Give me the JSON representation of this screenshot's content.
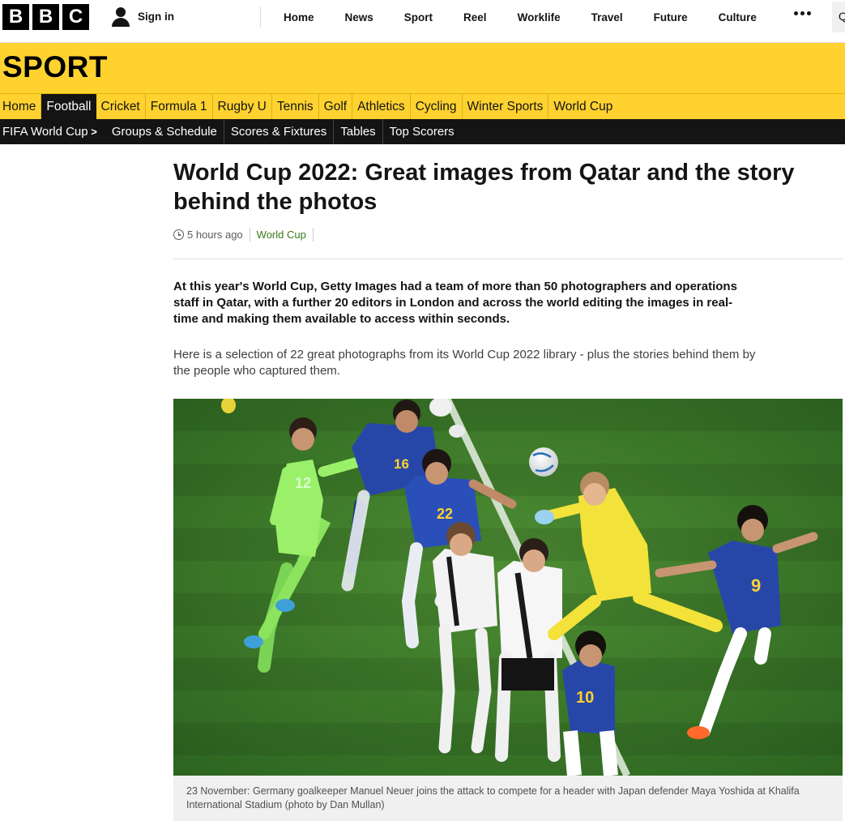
{
  "masthead": {
    "logo_letters": [
      "B",
      "B",
      "C"
    ],
    "signin_label": "Sign in",
    "nav_items": [
      "Home",
      "News",
      "Sport",
      "Reel",
      "Worklife",
      "Travel",
      "Future",
      "Culture"
    ],
    "more_icon": "more-dots-icon",
    "search_icon": "search-icon",
    "search_glyph": "Q"
  },
  "sport": {
    "title": "SPORT",
    "colors": {
      "banner": "#ffd230",
      "subnav": "#141414"
    },
    "nav_items": [
      "Home",
      "Football",
      "Cricket",
      "Formula 1",
      "Rugby U",
      "Tennis",
      "Golf",
      "Athletics",
      "Cycling",
      "Winter Sports",
      "World Cup"
    ],
    "active_item": "Football",
    "sub_nav": {
      "section": "FIFA World Cup",
      "items": [
        "Groups & Schedule",
        "Scores & Fixtures",
        "Tables",
        "Top Scorers"
      ]
    }
  },
  "article": {
    "headline": "World Cup 2022: Great images from Qatar and the story behind the photos",
    "time": "5 hours ago",
    "tag": "World Cup",
    "tag_color": "#3a7a1e",
    "intro": "At this year's World Cup, Getty Images had a team of more than 50 photographers and operations staff in Qatar, with a further 20 editors in London and across the world editing the images in real-time and making them available to access within seconds.",
    "paragraph": "Here is a selection of 22 great photographs from its World Cup 2022 library - plus the stories behind them by the people who captured them.",
    "photo_caption": "23 November: Germany goalkeeper Manuel Neuer joins the attack to compete for a header with Japan defender Maya Yoshida at Khalifa International Stadium (photo by Dan Mullan)",
    "photo_numbers": [
      "12",
      "16",
      "22",
      "9",
      "10"
    ]
  }
}
